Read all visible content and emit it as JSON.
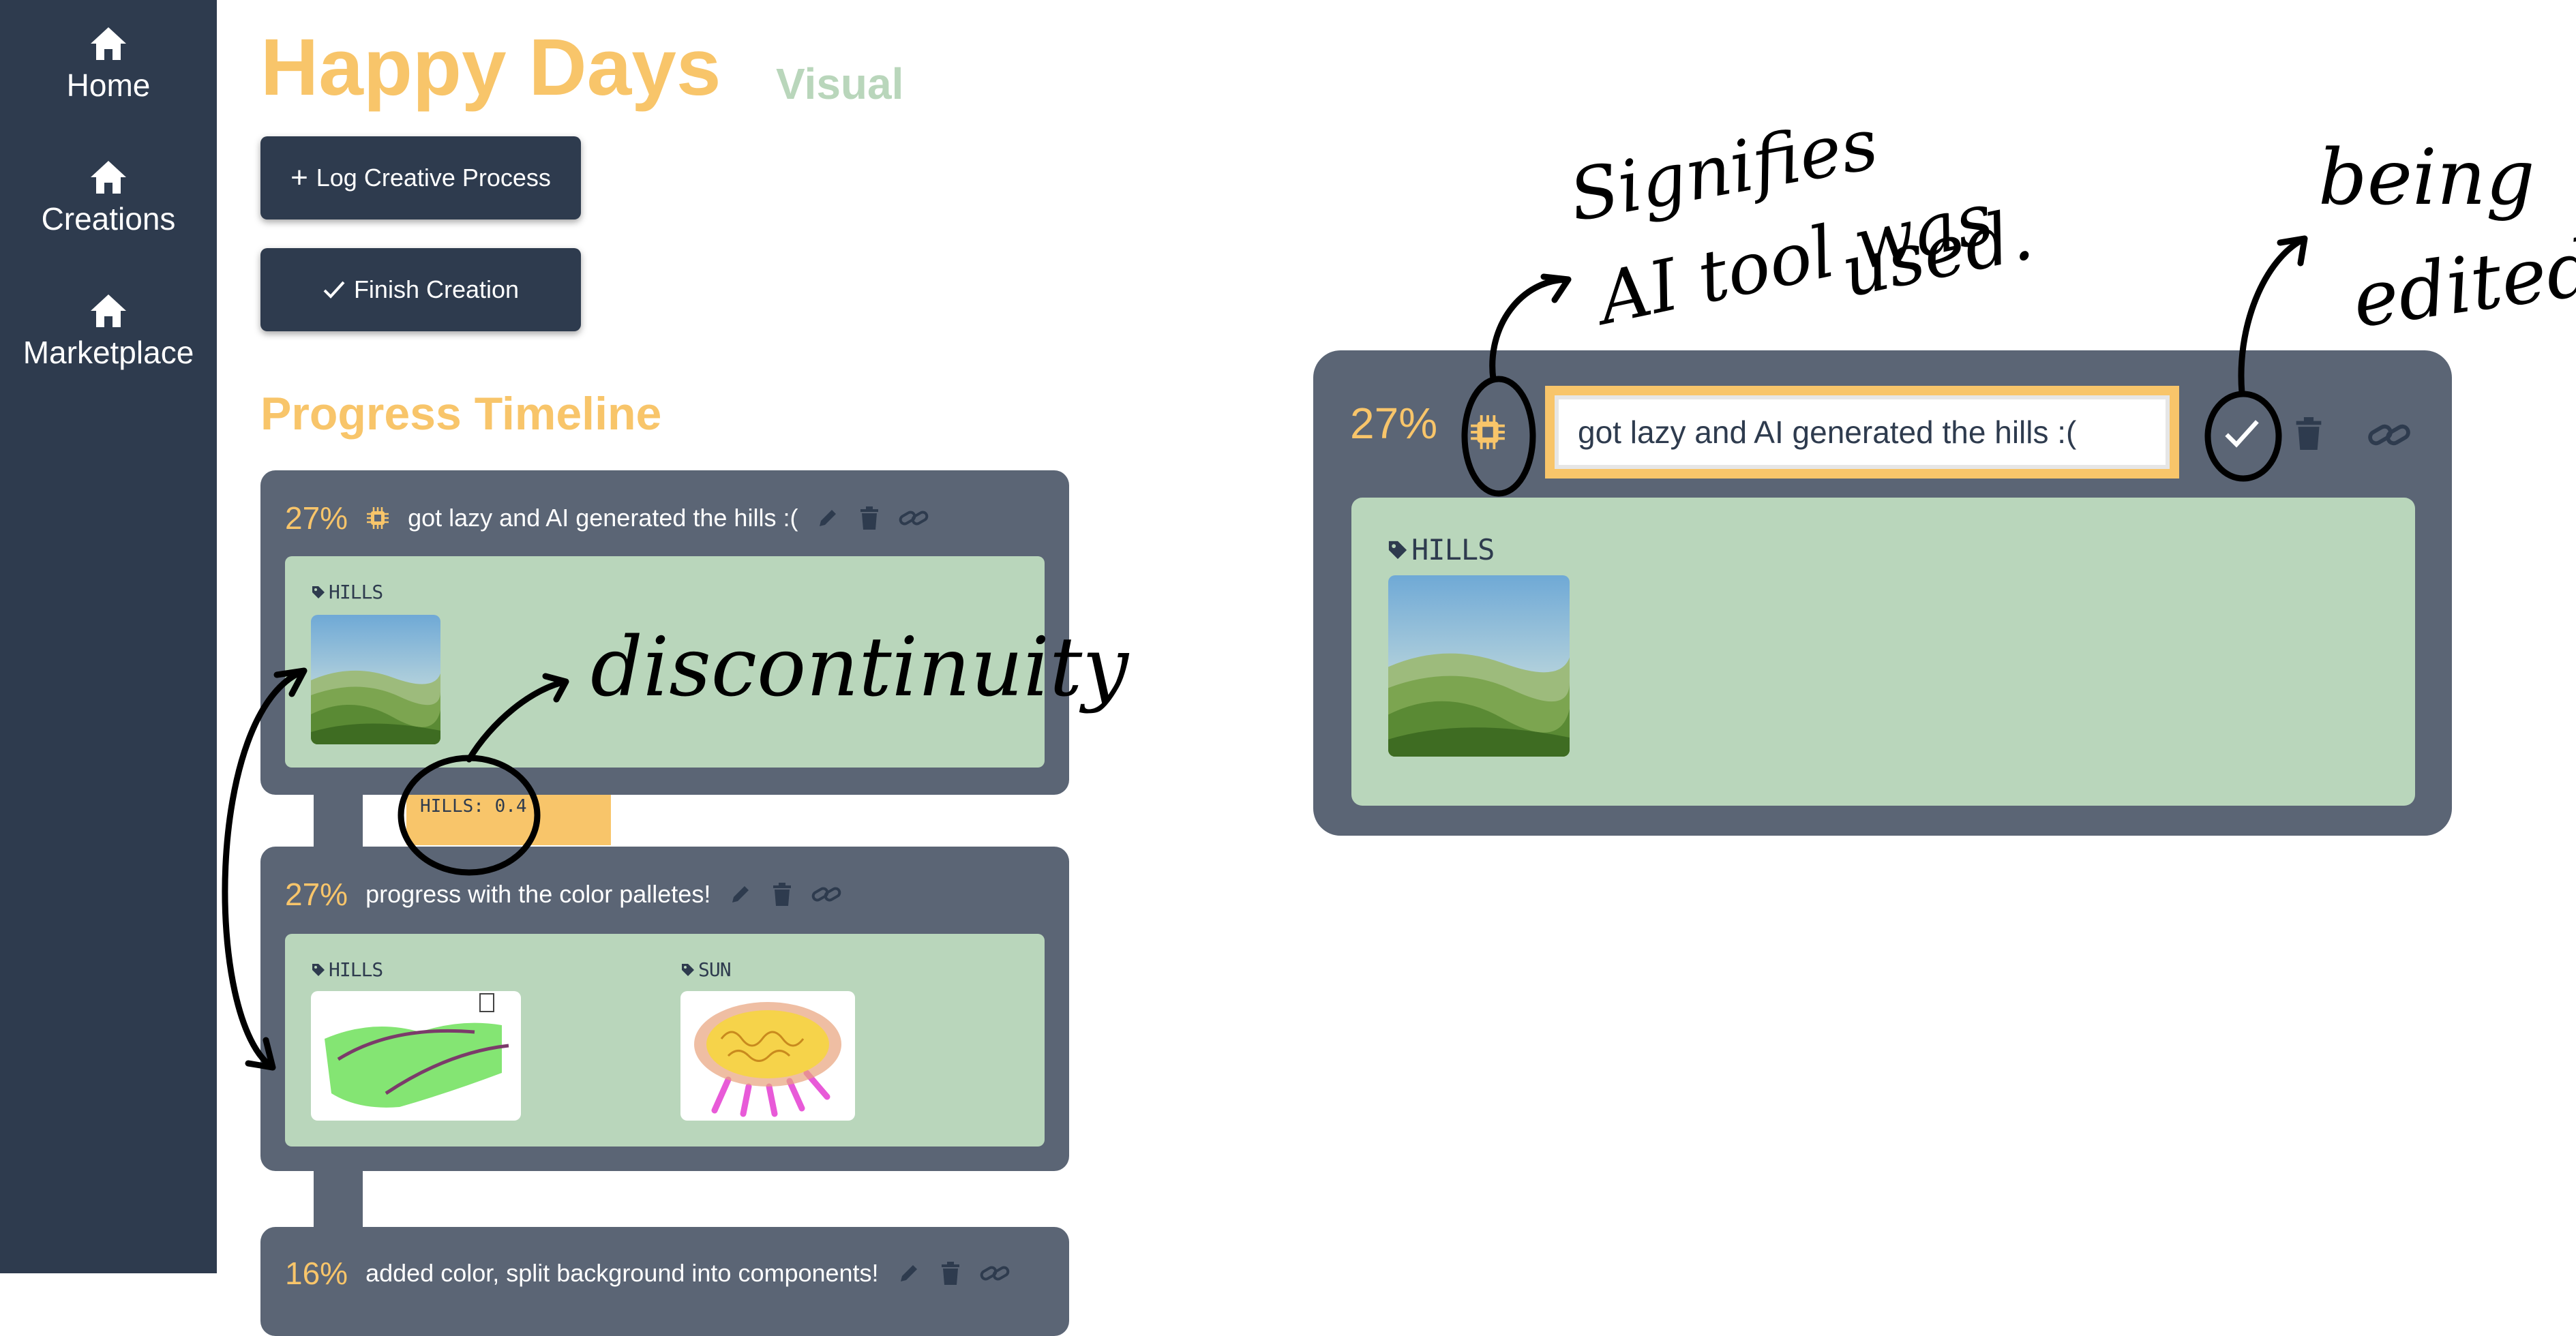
{
  "sidebar": {
    "items": [
      {
        "label": "Home",
        "icon": "home-icon"
      },
      {
        "label": "Creations",
        "icon": "home-icon"
      },
      {
        "label": "Marketplace",
        "icon": "home-icon"
      }
    ]
  },
  "header": {
    "title": "Happy Days",
    "subtitle": "Visual"
  },
  "actions": {
    "log_label": "Log Creative Process",
    "finish_label": "Finish Creation"
  },
  "timeline": {
    "title": "Progress Timeline",
    "entries": [
      {
        "percent": "27%",
        "ai_icon": "chip-icon",
        "description": "got lazy and AI generated the hills :(",
        "tags": [
          "HILLS"
        ]
      },
      {
        "percent": "27%",
        "description": "progress with the color palletes!",
        "tags": [
          "HILLS",
          "SUN"
        ]
      },
      {
        "percent": "16%",
        "description": "added color, split background into components!"
      }
    ],
    "connector_chip": "HILLS: 0.4"
  },
  "edit_view": {
    "percent": "27%",
    "input_value": "got lazy and AI generated the hills :(",
    "tag": "HILLS"
  },
  "annotations": {
    "discontinuity": "discontinuity",
    "ai_line1": "Signifies",
    "ai_line2": "AI tool was",
    "ai_line3": "used.",
    "edit_line1": "being",
    "edit_line2": "edited"
  },
  "colors": {
    "sidebar": "#2e3b4e",
    "card": "#5b6575",
    "accent": "#f8c56a",
    "panel": "#b9d6bb"
  }
}
